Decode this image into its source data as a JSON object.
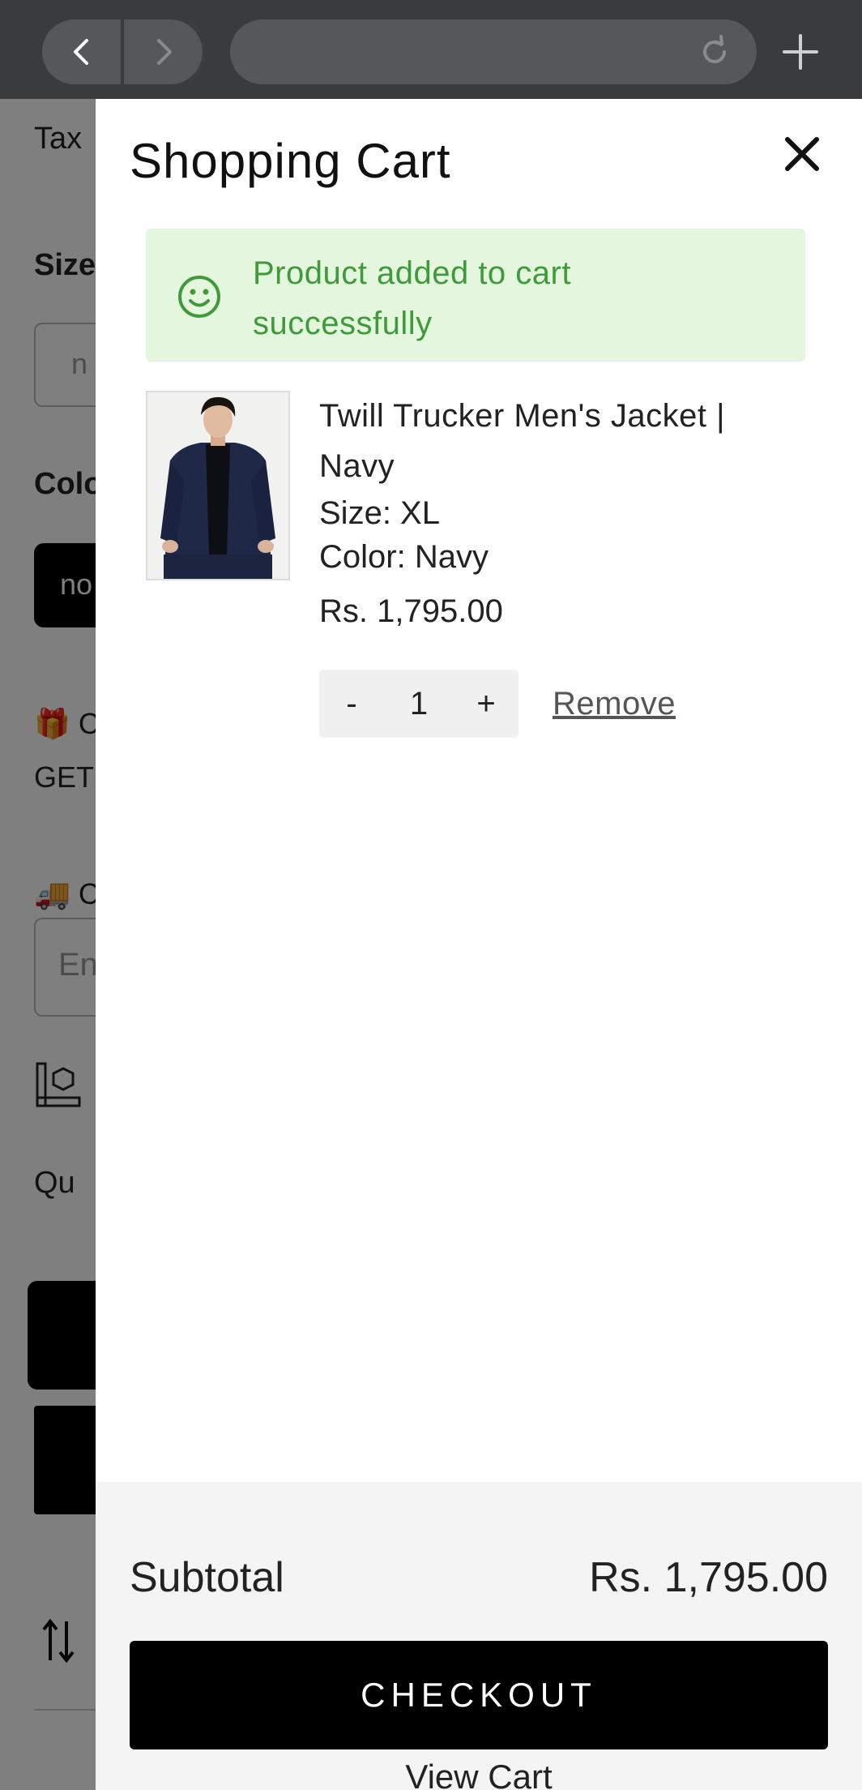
{
  "browser": {
    "back_icon": "chevron-left-icon",
    "forward_icon": "chevron-right-icon",
    "reload_icon": "reload-icon",
    "new_tab_icon": "plus-icon"
  },
  "background_page": {
    "tax_text": "Tax",
    "size_label": "Size",
    "size_value": "n",
    "color_label": "Colo",
    "color_chip": "no",
    "offer_text": "🎁 C",
    "offer_code": "GET",
    "delivery_text": "🚚 C",
    "pincode_placeholder": "En",
    "quantity_label": "Qu"
  },
  "cart": {
    "title": "Shopping Cart",
    "alert_message": "Product added to cart successfully",
    "alert_color": "#3f9a3a",
    "items": [
      {
        "title": "Twill Trucker Men's Jacket | Navy",
        "size": "Size: XL",
        "color": "Color: Navy",
        "price": "Rs. 1,795.00",
        "quantity": "1",
        "decrement_label": "-",
        "increment_label": "+",
        "remove_label": "Remove"
      }
    ],
    "subtotal_label": "Subtotal",
    "subtotal_value": "Rs. 1,795.00",
    "checkout_label": "CHECKOUT",
    "view_cart_label": "View Cart"
  }
}
